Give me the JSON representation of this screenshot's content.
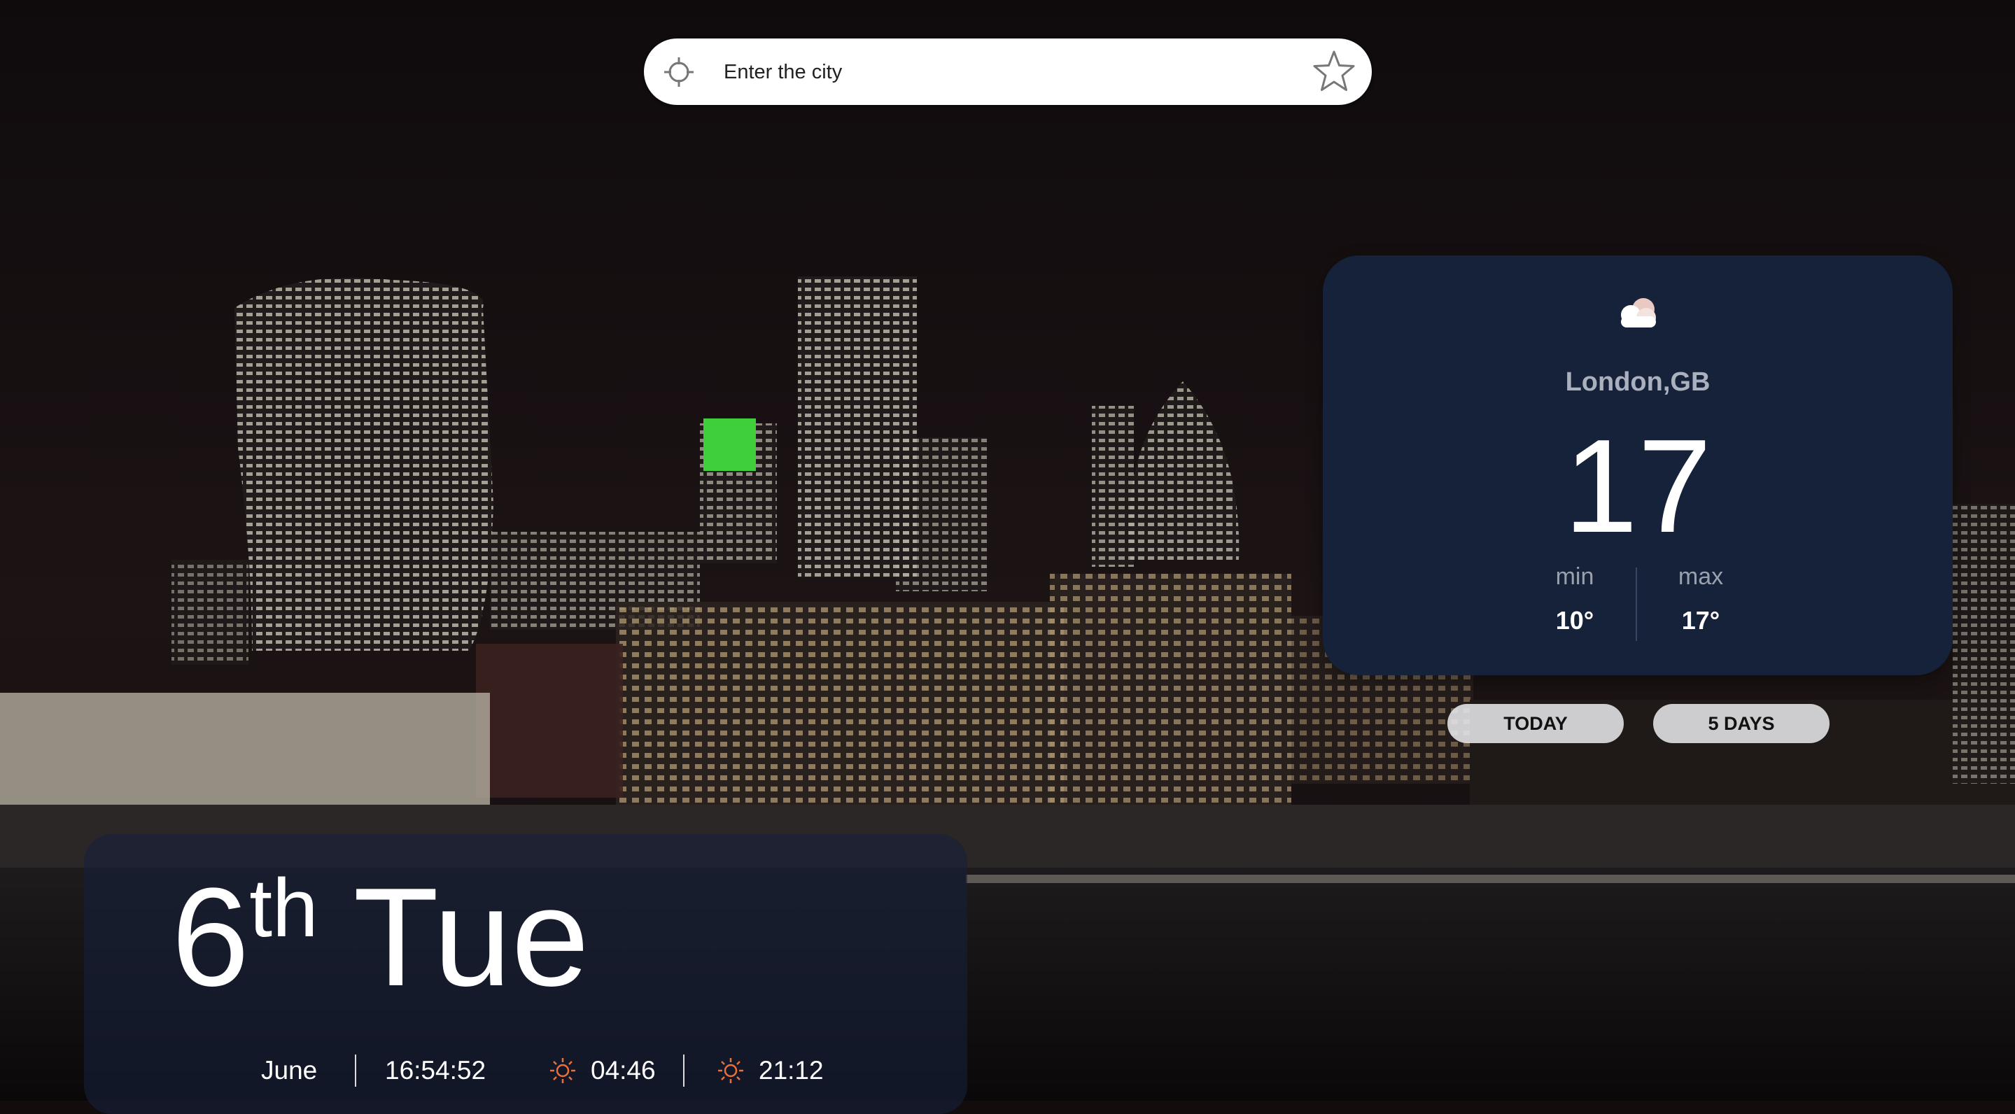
{
  "search": {
    "placeholder": "Enter the city"
  },
  "icons": {
    "locate": "crosshair-icon",
    "favorite": "star-icon",
    "weather": "cloud-icon",
    "sunrise": "sunrise-icon",
    "sunset": "sunset-icon"
  },
  "weather": {
    "city": "London,GB",
    "temperature": "17",
    "min_label": "min",
    "max_label": "max",
    "min_value": "10°",
    "max_value": "17°"
  },
  "tabs": {
    "today": "TODAY",
    "five_days": "5 DAYS"
  },
  "date": {
    "day": "6",
    "suffix": "th",
    "weekday": "Tue",
    "month": "June",
    "time": "16:54:52",
    "sunrise": "04:46",
    "sunset": "21:12"
  },
  "colors": {
    "card": "#16213a",
    "sun_icon": "#e8703a",
    "panel": "#16213a"
  }
}
